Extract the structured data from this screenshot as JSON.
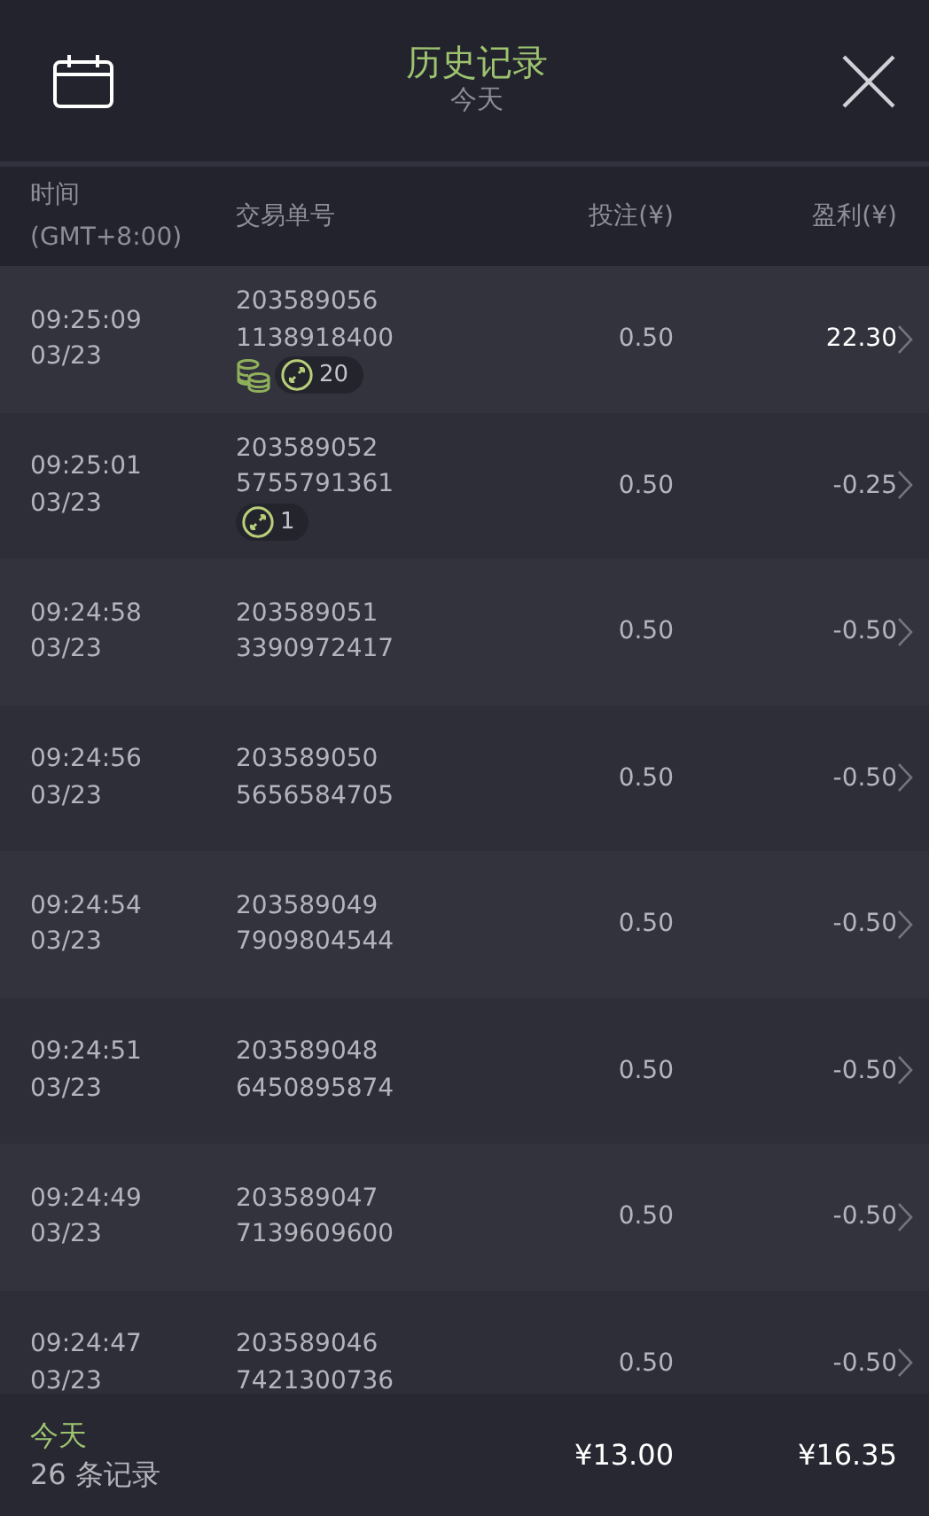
{
  "header": {
    "title": "历史记录",
    "subtitle": "今天"
  },
  "columns": [
    {
      "label": "时间",
      "sub": "(GMT+8:00)"
    },
    {
      "label": "交易单号"
    },
    {
      "label": "投注(¥)"
    },
    {
      "label": "盈利(¥)"
    }
  ],
  "rows": [
    {
      "time": "09:25:09",
      "date": "03/23",
      "order_1": "203589056",
      "order_2": "1138918400",
      "coins": true,
      "spins": "20",
      "stake": "0.50",
      "profit": "22.30",
      "win": true
    },
    {
      "time": "09:25:01",
      "date": "03/23",
      "order_1": "203589052",
      "order_2": "5755791361",
      "coins": false,
      "spins": "1",
      "stake": "0.50",
      "profit": "-0.25",
      "win": false
    },
    {
      "time": "09:24:58",
      "date": "03/23",
      "order_1": "203589051",
      "order_2": "3390972417",
      "coins": false,
      "stake": "0.50",
      "profit": "-0.50",
      "win": false
    },
    {
      "time": "09:24:56",
      "date": "03/23",
      "order_1": "203589050",
      "order_2": "5656584705",
      "coins": false,
      "stake": "0.50",
      "profit": "-0.50",
      "win": false
    },
    {
      "time": "09:24:54",
      "date": "03/23",
      "order_1": "203589049",
      "order_2": "7909804544",
      "coins": false,
      "stake": "0.50",
      "profit": "-0.50",
      "win": false
    },
    {
      "time": "09:24:51",
      "date": "03/23",
      "order_1": "203589048",
      "order_2": "6450895874",
      "coins": false,
      "stake": "0.50",
      "profit": "-0.50",
      "win": false
    },
    {
      "time": "09:24:49",
      "date": "03/23",
      "order_1": "203589047",
      "order_2": "7139609600",
      "coins": false,
      "stake": "0.50",
      "profit": "-0.50",
      "win": false
    },
    {
      "time": "09:24:47",
      "date": "03/23",
      "order_1": "203589046",
      "order_2": "7421300736",
      "coins": false,
      "stake": "0.50",
      "profit": "-0.50",
      "win": false
    }
  ],
  "footer": {
    "period": "今天",
    "count": "26 条记录",
    "total_stake": "¥13.00",
    "total_profit": "¥16.35"
  }
}
